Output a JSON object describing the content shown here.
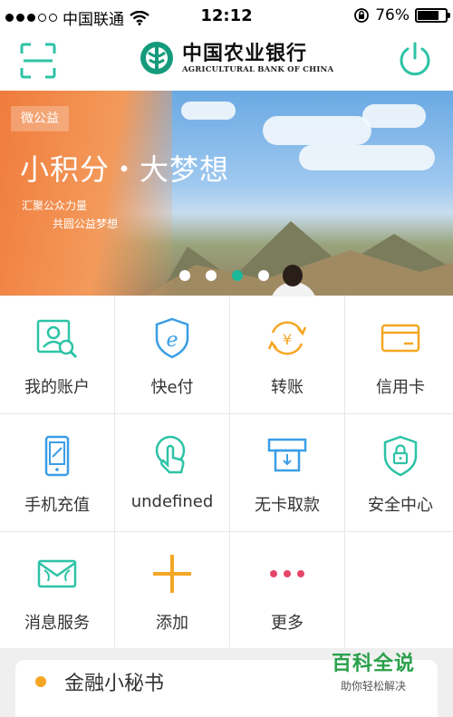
{
  "status_bar": {
    "carrier": "中国联通",
    "time": "12:12",
    "battery": "76%",
    "battery_level": 0.76
  },
  "header": {
    "logo_cn": "中国农业银行",
    "logo_en": "AGRICULTURAL BANK OF CHINA",
    "left_icon": "scan-icon",
    "right_icon": "power-icon",
    "accent": "#2cc3a5"
  },
  "banner": {
    "tag": "微公益",
    "slogan": "小积分・大梦想",
    "line1": "汇聚公众力量",
    "line2": "共圆公益梦想",
    "pages": 4,
    "active_page": 3
  },
  "menu": {
    "items": [
      {
        "label": "我的账户",
        "icon": "account-icon",
        "color": "#2cc3a5"
      },
      {
        "label": "快e付",
        "icon": "e-pay-icon",
        "color": "#3a9ee6"
      },
      {
        "label": "转账",
        "icon": "transfer-icon",
        "color": "#f5a623"
      },
      {
        "label": "信用卡",
        "icon": "credit-card-icon",
        "color": "#f5a623"
      },
      {
        "label": "手机充值",
        "icon": "phone-topup-icon",
        "color": "#3a9ee6"
      },
      {
        "label": "undefined",
        "icon": "touch-icon",
        "color": "#2cc3a5"
      },
      {
        "label": "无卡取款",
        "icon": "cardless-withdraw-icon",
        "color": "#3a9ee6"
      },
      {
        "label": "安全中心",
        "icon": "security-shield-icon",
        "color": "#2cc3a5"
      },
      {
        "label": "消息服务",
        "icon": "message-icon",
        "color": "#2cc3a5"
      },
      {
        "label": "添加",
        "icon": "plus-icon",
        "color": "#f5a623"
      },
      {
        "label": "更多",
        "icon": "more-icon",
        "color": "#e8456b"
      }
    ]
  },
  "card": {
    "title": "金融小秘书"
  },
  "watermark": {
    "title": "百科全说",
    "subtitle": "助你轻松解决"
  }
}
